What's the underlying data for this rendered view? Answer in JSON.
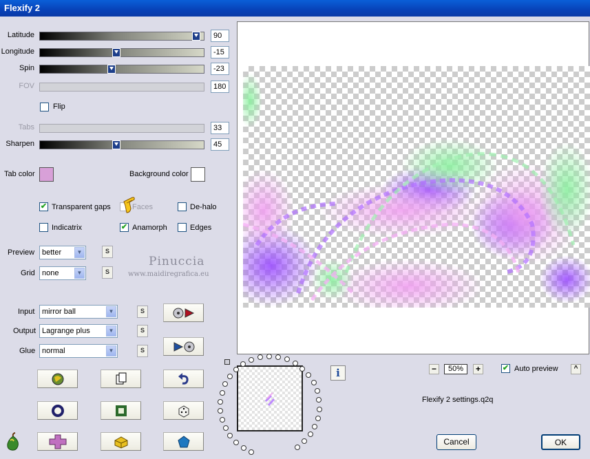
{
  "window": {
    "title": "Flexify 2"
  },
  "sliders": [
    {
      "label": "Latitude",
      "value": "90",
      "fraction": 0.97,
      "enabled": true
    },
    {
      "label": "Longitude",
      "value": "-15",
      "fraction": 0.46,
      "enabled": true
    },
    {
      "label": "Spin",
      "value": "-23",
      "fraction": 0.43,
      "enabled": true
    },
    {
      "label": "FOV",
      "value": "180",
      "fraction": null,
      "enabled": false
    },
    {
      "label": "Tabs",
      "value": "33",
      "fraction": null,
      "enabled": false
    },
    {
      "label": "Sharpen",
      "value": "45",
      "fraction": 0.46,
      "enabled": true
    }
  ],
  "flip": {
    "label": "Flip",
    "checked": false
  },
  "colors": {
    "tab_label": "Tab color",
    "tab_value": "#d8a0d8",
    "bg_label": "Background color",
    "bg_value": "#ffffff"
  },
  "options": {
    "transparent_gaps": {
      "label": "Transparent gaps",
      "checked": true
    },
    "faces": {
      "label": "Faces",
      "checked": false
    },
    "de_halo": {
      "label": "De-halo",
      "checked": false
    },
    "indicatrix": {
      "label": "Indicatrix",
      "checked": false
    },
    "anamorph": {
      "label": "Anamorph",
      "checked": true
    },
    "edges": {
      "label": "Edges",
      "checked": false
    }
  },
  "preview_select": {
    "label": "Preview",
    "value": "better"
  },
  "grid_select": {
    "label": "Grid",
    "value": "none"
  },
  "watermark": {
    "name": "Pinuccia",
    "site": "www.maidiregrafica.eu"
  },
  "input_select": {
    "label": "Input",
    "value": "mirror ball"
  },
  "output_select": {
    "label": "Output",
    "value": "Lagrange plus"
  },
  "glue_select": {
    "label": "Glue",
    "value": "normal"
  },
  "small_btn_text": "S",
  "zoom": {
    "value": "50%",
    "minus": "−",
    "plus": "+"
  },
  "auto_preview": {
    "label": "Auto preview",
    "checked": true,
    "collapse_btn": "^"
  },
  "settings_file": "Flexify 2 settings.q2q",
  "info_btn": "i",
  "buttons": {
    "cancel": "Cancel",
    "ok": "OK"
  },
  "accent": {
    "titlebar": "#0842b8",
    "swirl_purple": "#9b4dff",
    "swirl_green": "#8cf0a0",
    "swirl_pink": "#f0a0f0"
  }
}
